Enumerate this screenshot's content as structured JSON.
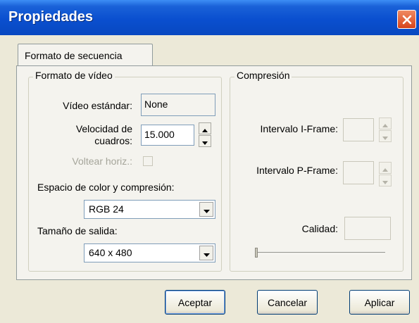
{
  "window": {
    "title": "Propiedades"
  },
  "tabs": [
    {
      "label": "Formato de secuencia"
    }
  ],
  "video_format": {
    "group_title": "Formato de vídeo",
    "standard_label": "Vídeo estándar:",
    "standard_value": "None",
    "frame_rate_label_line1": "Velocidad de",
    "frame_rate_label_line2": "cuadros:",
    "frame_rate_value": "15.000",
    "flip_label": "Voltear horiz.:",
    "color_space_label": "Espacio de color y compresión:",
    "color_space_value": "RGB 24",
    "output_size_label": "Tamaño de salida:",
    "output_size_value": "640 x 480"
  },
  "compression": {
    "group_title": "Compresión",
    "iframe_label": "Intervalo I-Frame:",
    "iframe_value": "",
    "pframe_label": "Intervalo P-Frame:",
    "pframe_value": "",
    "quality_label": "Calidad:",
    "quality_value": "",
    "quality_slider_level": 0
  },
  "buttons": {
    "accept": "Aceptar",
    "cancel": "Cancelar",
    "apply": "Aplicar"
  },
  "icons": {
    "close": "close-icon",
    "spin_up": "arrow-up-icon",
    "spin_down": "arrow-down-icon",
    "dropdown": "chevron-down-icon"
  }
}
